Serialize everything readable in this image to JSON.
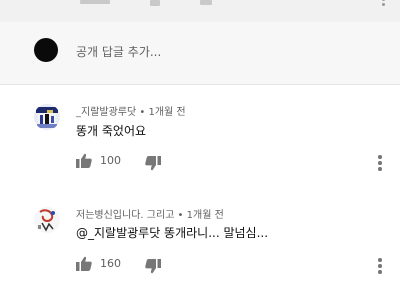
{
  "add_reply": {
    "placeholder": "공개 답글 추가..."
  },
  "comments": [
    {
      "author": "_지랄발광루닷",
      "time": "1개월 전",
      "text": "똥개 죽었어요",
      "likes": "100"
    },
    {
      "author": "저는병신입니다. 그리고",
      "time": "1개월 전",
      "text": "@_지랄발광루닷 똥개라니... 말넘심...",
      "likes": "160"
    }
  ],
  "separator": "•",
  "icons": [
    "thumbs-up-icon",
    "thumbs-down-icon",
    "more-vert-icon"
  ],
  "colors": {
    "meta_text": "#606060",
    "icon_gray": "#777777",
    "top_strip_bg": "#f1f1f1",
    "add_reply_bg": "#f7f7f7"
  }
}
